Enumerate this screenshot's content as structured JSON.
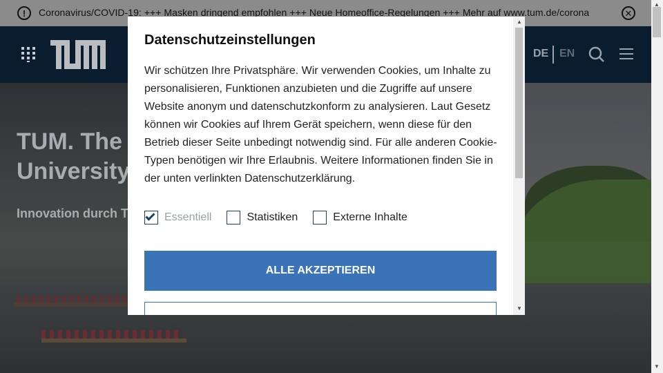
{
  "banner": {
    "icon": "warning-circle-icon",
    "text": "Coronavirus/COVID-19: +++ Masken dringend empfohlen +++ Neue Homeoffice-Regelungen +++ Mehr auf www.tum.de/corona",
    "close_icon": "close-circle-icon"
  },
  "header": {
    "apps_icon": "apps-grid-icon",
    "logo": "TUM",
    "lang_de": "DE",
    "lang_en": "EN",
    "search_icon": "search-icon",
    "menu_icon": "hamburger-menu-icon"
  },
  "hero": {
    "title_line1": "TUM. The",
    "title_line2": "University",
    "subtitle": "Innovation durch T"
  },
  "modal": {
    "title": "Datenschutzeinstellungen",
    "body": "Wir schützen Ihre Privatsphäre. Wir verwenden Cookies, um Inhalte zu personalisieren, Funktionen anzubieten und die Zugriffe auf unsere Website anonym und datenschutzkonform zu analysieren. Laut Gesetz können wir Cookies auf Ihrem Gerät speichern, wenn diese für den Betrieb dieser Seite unbedingt notwendig sind. Für alle anderen Cookie-Typen benötigen wir Ihre Erlaubnis. Weitere Informationen finden Sie in der unten verlinkten Datenschutzerklärung.",
    "options": [
      {
        "label": "Essentiell",
        "checked": true,
        "disabled": true
      },
      {
        "label": "Statistiken",
        "checked": false,
        "disabled": false
      },
      {
        "label": "Externe Inhalte",
        "checked": false,
        "disabled": false
      }
    ],
    "accept_all": "ALLE AKZEPTIEREN"
  },
  "colors": {
    "banner_bg": "#8a8b8a",
    "header_bg": "#0a1d2e",
    "accent": "#3b73b9"
  }
}
